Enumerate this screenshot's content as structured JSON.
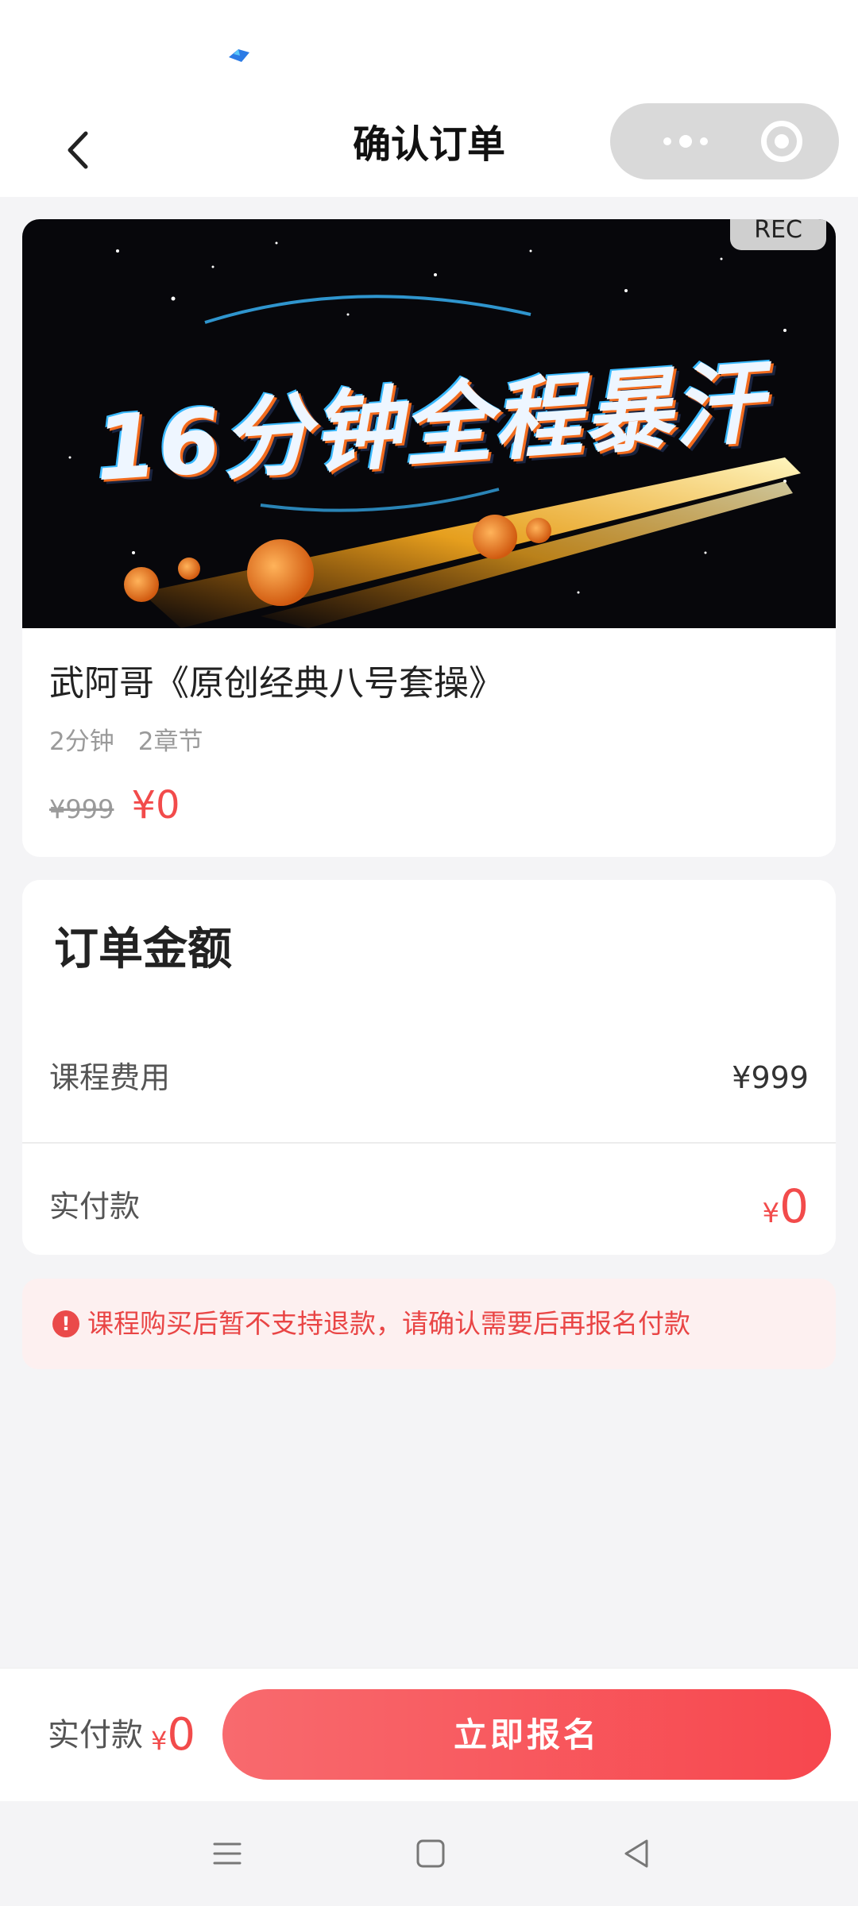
{
  "nav": {
    "title": "确认订单"
  },
  "course": {
    "banner_text": "16分钟全程暴汗",
    "rec_label": "REC",
    "name": "武阿哥《原创经典八号套操》",
    "duration": "2分钟",
    "chapters": "2章节",
    "original_price": "¥999",
    "current_price": "¥0"
  },
  "summary": {
    "title": "订单金额",
    "fee_label": "课程费用",
    "fee_value": "¥999",
    "paid_label": "实付款",
    "paid_symbol": "¥",
    "paid_value": "0"
  },
  "notice": {
    "icon": "!",
    "text": "课程购买后暂不支持退款，请确认需要后再报名付款"
  },
  "bottom": {
    "paid_label": "实付款",
    "paid_symbol": "¥",
    "paid_value": "0",
    "button_label": "立即报名"
  },
  "colors": {
    "accent": "#f24b4b",
    "button_start": "#f86a6e",
    "button_end": "#f7474e",
    "notice_bg": "#fdf0f0"
  }
}
